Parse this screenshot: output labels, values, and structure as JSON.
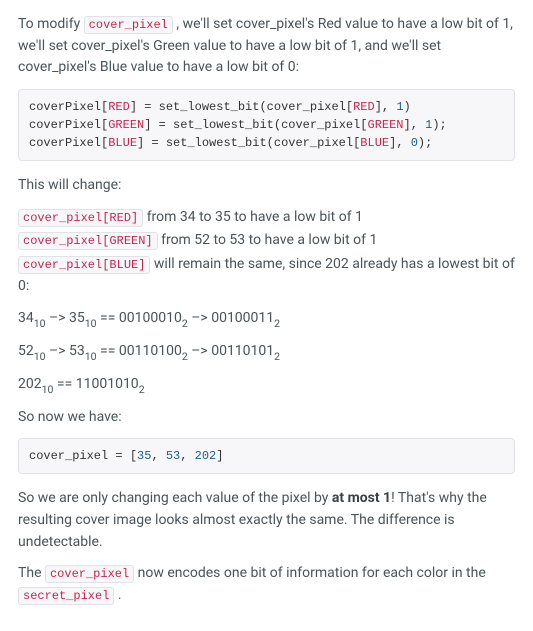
{
  "intro": {
    "before": "To modify ",
    "code": "cover_pixel",
    "after": " , we'll set cover_pixel's Red value to have a low bit of 1, we'll set cover_pixel's Green value to have a low bit of 1, and we'll set cover_pixel's Blue value to have a low bit of 0:"
  },
  "code1": {
    "lines": [
      {
        "lhs_arr": "coverPixel",
        "lhs_idx": "RED",
        "func": "set_lowest_bit",
        "arg_arr": "cover_pixel",
        "arg_idx": "RED",
        "num": "1",
        "trail": ")"
      },
      {
        "lhs_arr": "coverPixel",
        "lhs_idx": "GREEN",
        "func": "set_lowest_bit",
        "arg_arr": "cover_pixel",
        "arg_idx": "GREEN",
        "num": "1",
        "trail": ");"
      },
      {
        "lhs_arr": "coverPixel",
        "lhs_idx": "BLUE",
        "func": "set_lowest_bit",
        "arg_arr": "cover_pixel",
        "arg_idx": "BLUE",
        "num": "0",
        "trail": ");"
      }
    ]
  },
  "change_heading": "This will change:",
  "changes": [
    {
      "code": "cover_pixel[RED]",
      "text": " from 34 to 35 to have a low bit of 1"
    },
    {
      "code": "cover_pixel[GREEN]",
      "text": " from 52 to 53 to have a low bit of 1"
    },
    {
      "code": "cover_pixel[BLUE]",
      "text": " will remain the same, since 202 already has a lowest bit of 0:"
    }
  ],
  "bits": [
    {
      "a": "34",
      "as": "10",
      "arrow": " –> ",
      "b": "35",
      "bs": "10",
      "eq": " == ",
      "c": "00100010",
      "cs": "2",
      "arrow2": " –> ",
      "d": "00100011",
      "ds": "2"
    },
    {
      "a": "52",
      "as": "10",
      "arrow": " –> ",
      "b": "53",
      "bs": "10",
      "eq": " == ",
      "c": "00110100",
      "cs": "2",
      "arrow2": " –> ",
      "d": "00110101",
      "ds": "2"
    },
    {
      "a": "202",
      "as": "10",
      "eq": " == ",
      "c": "11001010",
      "cs": "2"
    }
  ],
  "sonow": "So now we have:",
  "code2": {
    "lhs": "cover_pixel",
    "op": " = ",
    "vals": [
      "35",
      "53",
      "202"
    ]
  },
  "para_change": {
    "before": "So we are only changing each value of the pixel by ",
    "strong": "at most 1",
    "after": "! That's why the resulting cover image looks almost exactly the same. The difference is undetectable."
  },
  "para_encode": {
    "before": "The ",
    "code1": "cover_pixel",
    "mid": " now encodes one bit of information for each color in the ",
    "code2": "secret_pixel",
    "after": " ."
  }
}
